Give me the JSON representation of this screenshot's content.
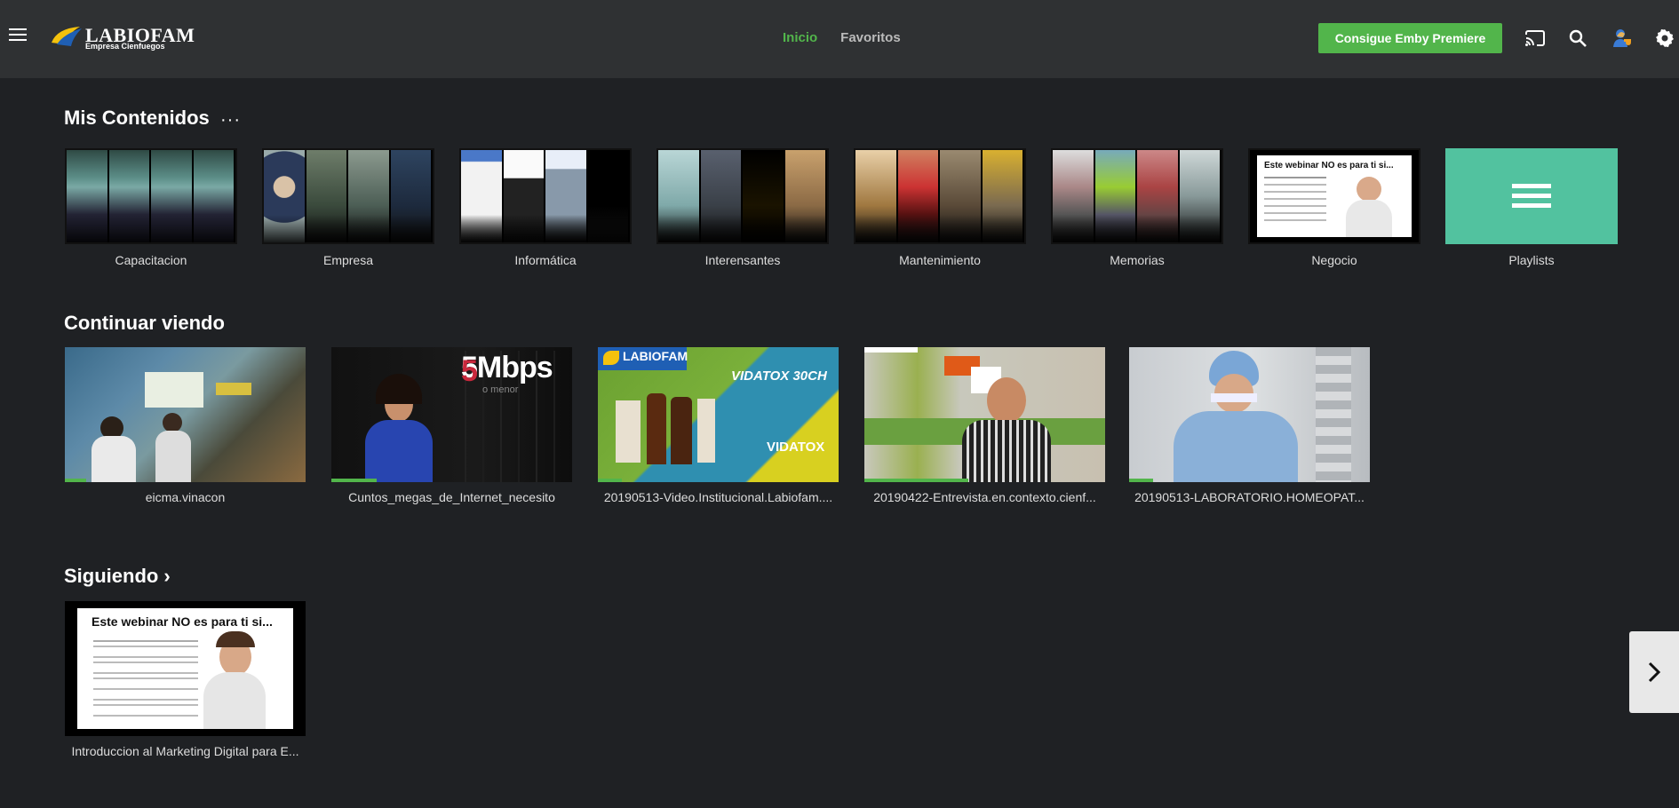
{
  "header": {
    "logo_text": "LABIOFAM",
    "logo_subtext": "Empresa Cienfuegos",
    "nav": [
      {
        "label": "Inicio",
        "active": true
      },
      {
        "label": "Favoritos",
        "active": false
      }
    ],
    "premiere_button": "Consigue Emby Premiere",
    "icons": [
      "menu-icon",
      "cast-icon",
      "search-icon",
      "user-icon",
      "gear-icon"
    ]
  },
  "sections": {
    "mis_contenidos": {
      "title": "Mis Contenidos",
      "more": "···",
      "libraries": [
        {
          "label": "Capacitacion"
        },
        {
          "label": "Empresa"
        },
        {
          "label": "Informática"
        },
        {
          "label": "Interensantes"
        },
        {
          "label": "Mantenimiento"
        },
        {
          "label": "Memorias"
        },
        {
          "label": "Negocio",
          "thumb_title": "Este webinar NO es para ti si..."
        },
        {
          "label": "Playlists"
        }
      ]
    },
    "continuar": {
      "title": "Continuar viendo",
      "items": [
        {
          "label": "eicma.vinacon",
          "progress": 0.09
        },
        {
          "label": "Cuntos_megas_de_Internet_necesito",
          "progress": 0.19,
          "overlay": "5Mbps",
          "overlay_sub": "o menor"
        },
        {
          "label": "20190513-Video.Institucional.Labiofam....",
          "progress": 0.1,
          "overlay": "VIDATOX 30CH",
          "overlay_sub": "VIDATOX"
        },
        {
          "label": "20190422-Entrevista.en.contexto.cienf...",
          "progress": 0.43
        },
        {
          "label": "20190513-LABORATORIO.HOMEOPAT...",
          "progress": 0.1
        }
      ]
    },
    "siguiendo": {
      "title": "Siguiendo",
      "chevron": "›",
      "items": [
        {
          "label": "Introduccion al Marketing Digital para E...",
          "thumb_title": "Este webinar NO es para ti si..."
        }
      ]
    }
  },
  "colors": {
    "accent": "#52b54b",
    "background": "#1f2124",
    "header": "#2f3133",
    "playlist": "#52c29f"
  }
}
